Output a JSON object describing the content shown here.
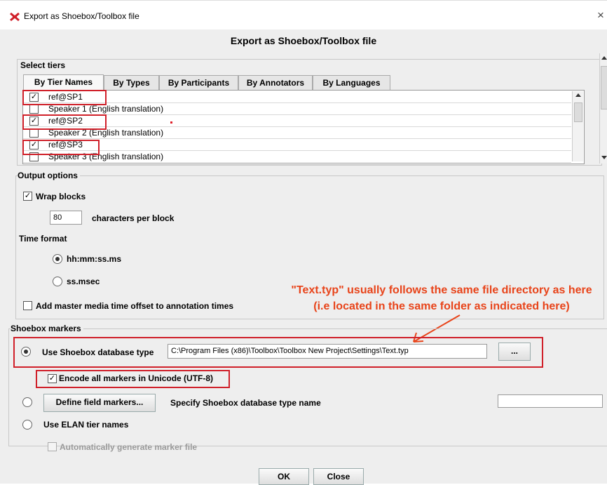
{
  "window": {
    "title": "Export as Shoebox/Toolbox file",
    "close_glyph": "×"
  },
  "dialog": {
    "title": "Export as Shoebox/Toolbox file"
  },
  "select_tiers": {
    "label": "Select tiers",
    "tabs": [
      {
        "label": "By Tier Names",
        "active": true
      },
      {
        "label": "By Types"
      },
      {
        "label": "By Participants"
      },
      {
        "label": "By Annotators"
      },
      {
        "label": "By Languages"
      }
    ],
    "rows": [
      {
        "label": "ref@SP1",
        "checked": true,
        "check": "✓"
      },
      {
        "label": "Speaker 1 (English translation)",
        "checked": false,
        "check": ""
      },
      {
        "label": "ref@SP2",
        "checked": true,
        "check": "✓"
      },
      {
        "label": "Speaker 2 (English translation)",
        "checked": false,
        "check": ""
      },
      {
        "label": "ref@SP3",
        "checked": true,
        "check": "✓"
      },
      {
        "label": "Speaker 3 (English translation)",
        "checked": false,
        "check": ""
      }
    ]
  },
  "output_options": {
    "label": "Output options",
    "wrap_blocks": {
      "label": "Wrap blocks",
      "checked": true,
      "check": "✓"
    },
    "chars_value": "80",
    "chars_label": "characters per block",
    "time_format_label": "Time format",
    "time_opt1": "hh:mm:ss.ms",
    "time_opt2": "ss.msec",
    "add_offset": {
      "label": "Add master media time offset to annotation times",
      "checked": false
    }
  },
  "annotation": {
    "line1": "\"Text.typ\" usually follows the same file directory as here",
    "line2": "(i.e located in the same folder as indicated here)",
    "color": "#e8441a"
  },
  "shoebox_markers": {
    "label": "Shoebox markers",
    "use_db_type_label": "Use Shoebox database type",
    "db_type_path": "C:\\Program Files (x86)\\Toolbox\\Toolbox New Project\\Settings\\Text.typ",
    "browse_label": "...",
    "encode_label": "Encode all markers in Unicode (UTF-8)",
    "encode_check": "✓",
    "define_button": "Define field markers...",
    "specify_label": "Specify Shoebox database type name",
    "specify_value": "",
    "use_elan_label": "Use ELAN tier names",
    "auto_generate_label": "Automatically generate marker file"
  },
  "footer": {
    "ok_label": "OK",
    "close_label": "Close"
  },
  "colors": {
    "highlight": "#d0202a",
    "dialog_bg": "#eeeeee",
    "arrow": "#e8441a"
  }
}
